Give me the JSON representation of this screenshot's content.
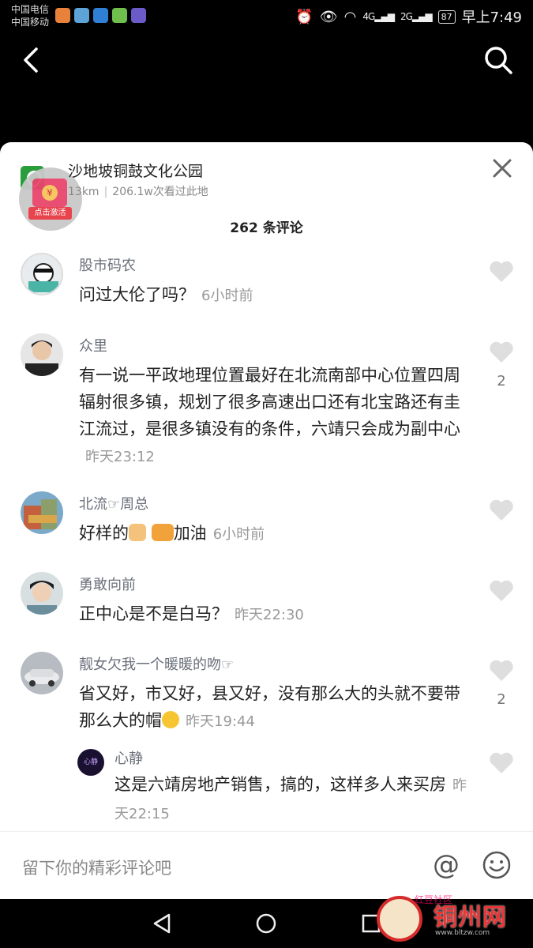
{
  "status_bar": {
    "carrier1": "中国电信",
    "carrier2": "中国移动",
    "signal1": "4G",
    "signal2": "2G",
    "battery": "87",
    "time": "早上7:49"
  },
  "location": {
    "title": "沙地坡铜鼓文化公园",
    "distance": "13km",
    "views": "206.1w次看过此地",
    "promo_label": "点击激活"
  },
  "comments_header": "262 条评论",
  "comments": [
    {
      "user": "股市码农",
      "text": "问过大伦了吗？",
      "time": "6小时前",
      "likes": ""
    },
    {
      "user": "众里",
      "text": "有一说一平政地理位置最好在北流南部中心位置四周辐射很多镇，规划了很多高速出口还有北宝路还有圭江流过，是很多镇没有的条件，六靖只会成为副中心",
      "time": "昨天23:12",
      "likes": "2"
    },
    {
      "user": "北流☞周总",
      "text_a": "好样的",
      "text_b": "加油",
      "time": "6小时前",
      "likes": ""
    },
    {
      "user": "勇敢向前",
      "text": "正中心是不是白马？",
      "time": "昨天22:30",
      "likes": ""
    },
    {
      "user": "靓女欠我一个暖暖的吻☞",
      "text": "省又好，市又好，县又好，没有那么大的头就不要带那么大的帽",
      "time": "昨天19:44",
      "likes": "2"
    }
  ],
  "reply": {
    "user": "心静",
    "avatar_text": "心静",
    "text": "这是六靖房地产销售，搞的，这样多人来买房",
    "time": "昨天22:15"
  },
  "input": {
    "placeholder": "留下你的精彩评论吧",
    "at_symbol": "@"
  },
  "watermark": {
    "name": "铜州网",
    "sub": "红豆社区",
    "url": "www.bltzw.com"
  },
  "colors": {
    "username": "#6a6f7a",
    "time": "#999999",
    "accent": "#e83535"
  }
}
